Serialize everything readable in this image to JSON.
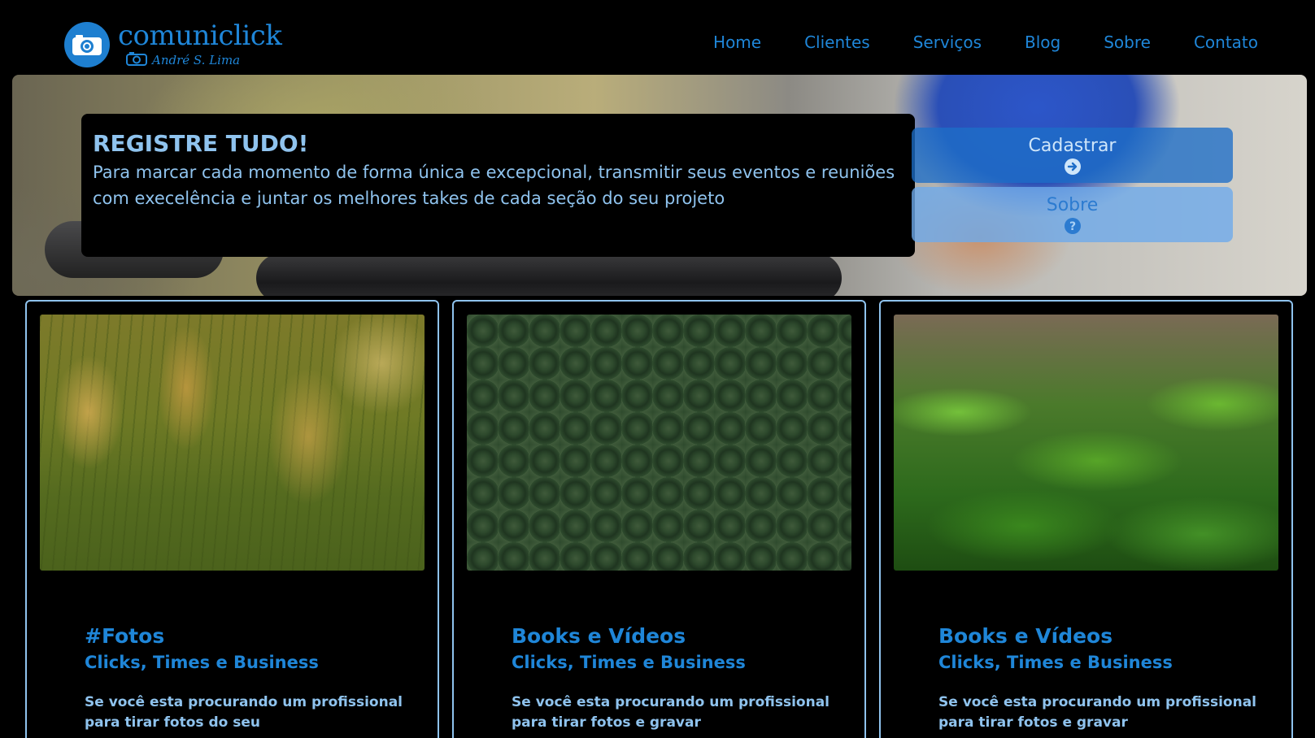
{
  "brand": {
    "name": "comuniclick",
    "subtitle": "André S. Lima",
    "icon": "camera-icon",
    "color": "#1f86d8"
  },
  "nav": {
    "items": [
      {
        "label": "Home"
      },
      {
        "label": "Clientes"
      },
      {
        "label": "Serviços"
      },
      {
        "label": "Blog"
      },
      {
        "label": "Sobre"
      },
      {
        "label": "Contato"
      }
    ]
  },
  "hero": {
    "title": "REGISTRE TUDO!",
    "text": "Para marcar cada momento de forma única e excepcional, transmitir seus eventos e reuniões com execelência e juntar os melhores takes de cada seção do seu projeto",
    "buttons": {
      "cadastrar": {
        "label": "Cadastrar",
        "icon": "arrow-right-circle-icon"
      },
      "sobre": {
        "label": "Sobre",
        "icon": "question-circle-icon"
      }
    }
  },
  "cards": [
    {
      "image": "grass-photo",
      "title": "#Fotos",
      "subtitle": "Clicks, Times e Business",
      "text": "Se você esta procurando um profissional para tirar fotos do seu"
    },
    {
      "image": "forest-photo",
      "title": "Books e Vídeos",
      "subtitle": "Clicks, Times e Business",
      "text": "Se você esta procurando um profissional para tirar fotos e gravar"
    },
    {
      "image": "lily-photo",
      "title": "Books e Vídeos",
      "subtitle": "Clicks, Times e Business",
      "text": "Se você esta procurando um profissional para tirar fotos e gravar"
    }
  ],
  "colors": {
    "background": "#000000",
    "accent": "#1f86d8",
    "text_light": "#8fc3ee"
  }
}
